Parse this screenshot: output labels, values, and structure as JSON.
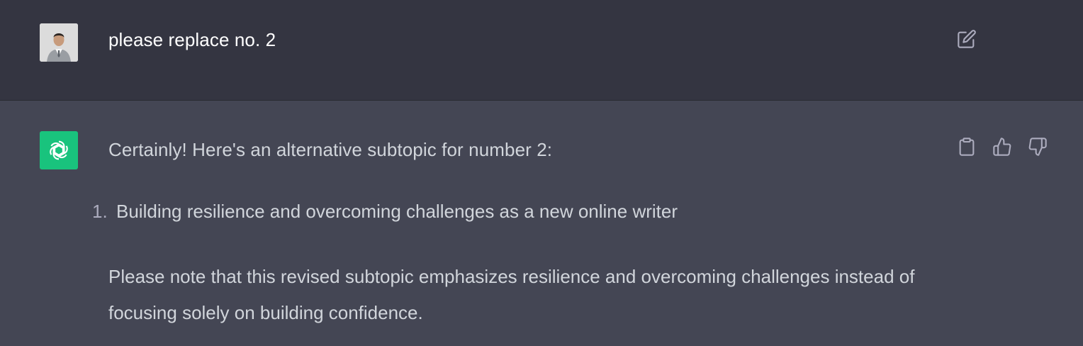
{
  "user_message": {
    "text": "please replace no. 2"
  },
  "assistant_message": {
    "lead": "Certainly! Here's an alternative subtopic for number 2:",
    "list_items": [
      {
        "number": "1.",
        "text": "Building resilience and overcoming challenges as a new online writer"
      }
    ],
    "note": "Please note that this revised subtopic emphasizes resilience and overcoming challenges instead of focusing solely on building confidence."
  },
  "icons": {
    "edit": "edit-icon",
    "copy": "clipboard-icon",
    "thumbs_up": "thumbs-up-icon",
    "thumbs_down": "thumbs-down-icon",
    "assistant_logo": "openai-logo-icon",
    "user_avatar": "user-avatar"
  },
  "colors": {
    "user_bg": "#343541",
    "assistant_bg": "#444654",
    "assistant_avatar_bg": "#19c37d",
    "text": "#d1d5db"
  }
}
